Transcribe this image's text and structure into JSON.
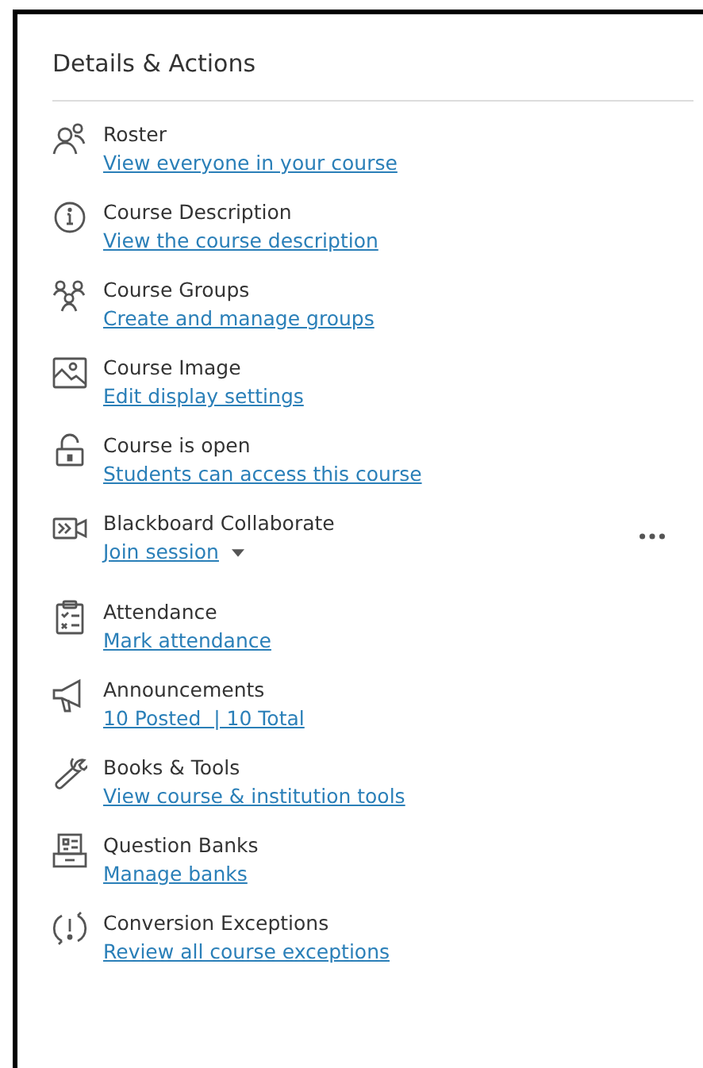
{
  "panel": {
    "title": "Details & Actions"
  },
  "items": [
    {
      "kind": "link",
      "title": "Roster",
      "link": "View everyone in your course"
    },
    {
      "kind": "link",
      "title": "Course Description",
      "link": "View the course description"
    },
    {
      "kind": "link",
      "title": "Course Groups",
      "link": "Create and manage groups"
    },
    {
      "kind": "link",
      "title": "Course Image",
      "link": "Edit display settings"
    },
    {
      "kind": "link",
      "title": "Course is open",
      "link": "Students can access this course"
    },
    {
      "kind": "dropdown",
      "title": "Blackboard Collaborate",
      "link": "Join session"
    },
    {
      "kind": "link",
      "title": "Attendance",
      "link": "Mark attendance"
    },
    {
      "kind": "link",
      "title": "Announcements",
      "link": "10 Posted  | 10 Total"
    },
    {
      "kind": "link",
      "title": "Books & Tools",
      "link": "View course & institution tools"
    },
    {
      "kind": "link",
      "title": "Question Banks",
      "link": "Manage banks"
    },
    {
      "kind": "link",
      "title": "Conversion Exceptions",
      "link": "Review all course exceptions"
    }
  ]
}
